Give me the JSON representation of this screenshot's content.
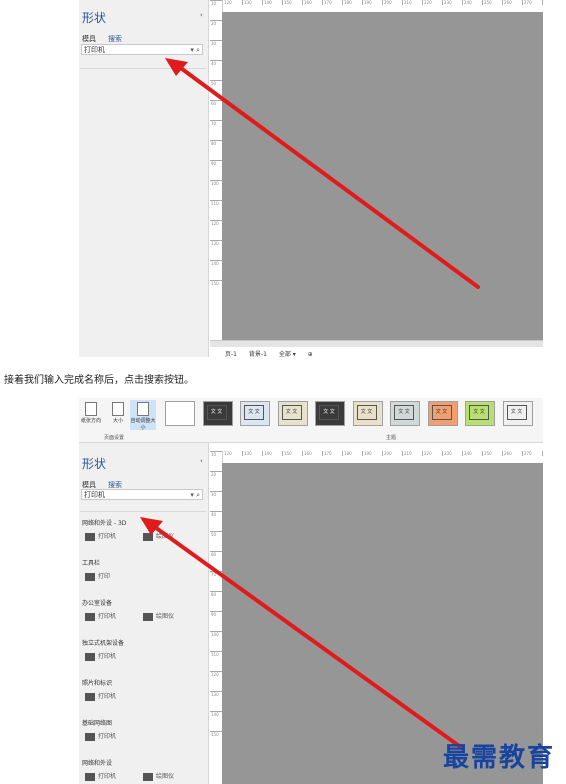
{
  "top": {
    "panel_title": "形状",
    "tabs": [
      "模具",
      "搜索"
    ],
    "search_value": "打印机",
    "search_controls": "▾ ⌕",
    "ruler_marks": [
      "120",
      "130",
      "140",
      "150",
      "160",
      "170",
      "180",
      "190",
      "200",
      "210",
      "220",
      "230",
      "240",
      "250",
      "260",
      "270",
      "280",
      "290",
      "300"
    ],
    "vruler_marks": [
      "10",
      "20",
      "30",
      "40",
      "50",
      "60",
      "70",
      "80",
      "90",
      "100",
      "110",
      "120",
      "130",
      "140",
      "150"
    ],
    "page_tabs": [
      "页-1",
      "背景-1",
      "全部 ▾",
      "⊕"
    ]
  },
  "caption": "接着我们输入完成名称后，点击搜索按钮。",
  "ribbon": {
    "buttons": [
      "纸张方向",
      "大小",
      "自动调整大小"
    ],
    "group_page_setup": "页面设置",
    "group_theme": "主题",
    "theme_glyph": "文 文",
    "theme_colors": [
      "#ffffff",
      "#3a3a3a",
      "#dde6f0",
      "#e6e2cc",
      "#3a3a3a",
      "#e8e0c8",
      "#d0d8d8",
      "#f0a070",
      "#b8e070",
      "#f0f0f0"
    ]
  },
  "bottom": {
    "panel_title": "形状",
    "tabs": [
      "模具",
      "搜索"
    ],
    "search_value": "打印机",
    "search_controls": "▾ ⌕",
    "ruler_marks": [
      "120",
      "130",
      "140",
      "150",
      "160",
      "170",
      "180",
      "190",
      "200",
      "210",
      "220",
      "230",
      "240",
      "250",
      "260",
      "270",
      "280",
      "290",
      "300"
    ],
    "categories": [
      {
        "title": "网络和外设 - 3D",
        "shapes": [
          "打印机",
          "绘图仪"
        ]
      },
      {
        "title": "工具栏",
        "shapes": [
          "打印"
        ]
      },
      {
        "title": "办公室设备",
        "shapes": [
          "打印机",
          "绘图仪"
        ]
      },
      {
        "title": "独立式机架设备",
        "shapes": [
          "打印机"
        ]
      },
      {
        "title": "照片和标识",
        "shapes": [
          "打印机"
        ]
      },
      {
        "title": "基础网络图",
        "shapes": [
          "打印机"
        ]
      },
      {
        "title": "网络和外设",
        "shapes": [
          "打印机",
          "绘图仪"
        ]
      }
    ]
  },
  "watermark": "最需教育",
  "colors": {
    "arrow": "#e01b1b",
    "accent": "#2b5797",
    "canvas": "#969696"
  }
}
